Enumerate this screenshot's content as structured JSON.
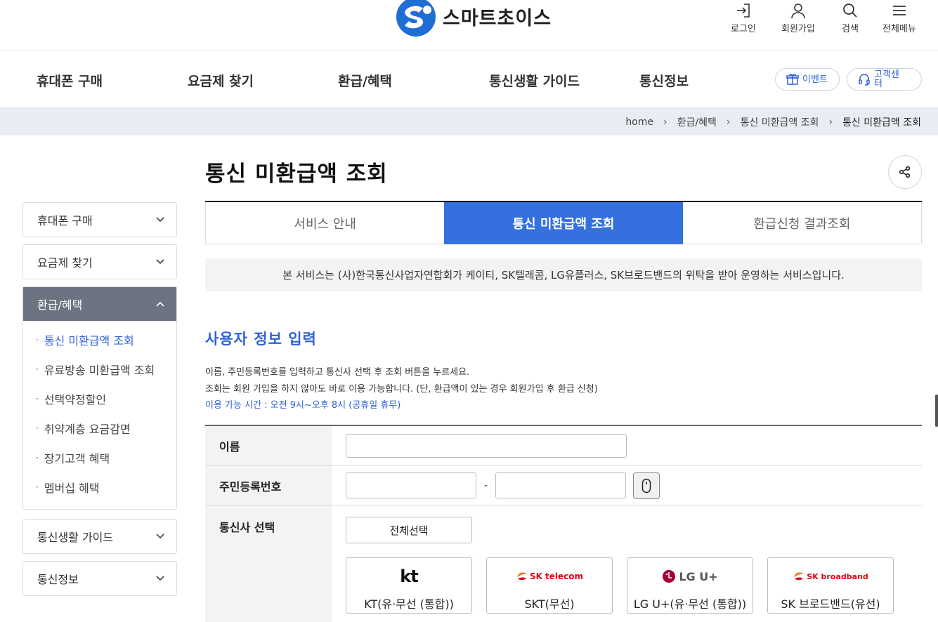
{
  "header": {
    "brand": "스마트초이스",
    "util": [
      {
        "label": "로그인",
        "icon": "login-icon"
      },
      {
        "label": "회원가입",
        "icon": "user-icon"
      },
      {
        "label": "검색",
        "icon": "search-icon"
      },
      {
        "label": "전체메뉴",
        "icon": "menu-icon"
      }
    ]
  },
  "gnb": {
    "items": [
      "휴대폰 구매",
      "요금제 찾기",
      "환급/혜택",
      "통신생활 가이드",
      "통신정보"
    ],
    "event_label": "이벤트",
    "support_label": "고객센터"
  },
  "breadcrumb": [
    "home",
    "환급/혜택",
    "통신 미환급액 조회",
    "통신 미환급액 조회"
  ],
  "page_title": "통신 미환급액 조회",
  "sidebar": {
    "sections": [
      {
        "label": "휴대폰 구매"
      },
      {
        "label": "요금제 찾기"
      },
      {
        "label": "환급/혜택",
        "sub": [
          "통신 미환급액 조회",
          "유료방송 미환급액 조회",
          "선택약정할인",
          "취약계층 요금감면",
          "장기고객 혜택",
          "멤버십 혜택"
        ]
      },
      {
        "label": "통신생활 가이드"
      },
      {
        "label": "통신정보"
      }
    ]
  },
  "tabs": [
    "서비스 안내",
    "통신 미환급액 조회",
    "환급신청 결과조회"
  ],
  "notice": "본 서비스는 (사)한국통신사업자연합회가 케이티, SK텔레콤, LG유플러스, SK브로드밴드의 위탁을 받아 운영하는 서비스입니다.",
  "section_title": "사용자 정보 입력",
  "desc": {
    "line1": "이름, 주민등록번호를 입력하고 통신사 선택 후 조회 버튼을 누르세요.",
    "line2": "조회는 회원 가입을 하지 않아도 바로 이용 가능합니다. (단, 환급액이 있는 경우 회원가입 후 환급 신청)",
    "hours": "이용 가능 시간 : 오전 9시~오후 8시 (공휴일 휴무)"
  },
  "form": {
    "name_label": "이름",
    "name_value": "",
    "rrn_label": "주민등록번호",
    "rrn_sep": "-",
    "carrier_label": "통신사 선택",
    "select_all": "전체선택",
    "carriers": [
      {
        "logo": "kt",
        "name": "KT(유·무선 (통합))"
      },
      {
        "logo": "SK telecom",
        "name": "SKT(무선)"
      },
      {
        "logo": "LG U+",
        "name": "LG U+(유·무선 (통합))"
      },
      {
        "logo": "SK broadband",
        "name": "SK 브로드밴드(유선)"
      }
    ]
  },
  "colors": {
    "accent": "#3470de",
    "link": "#2f62d6",
    "sidebar_active": "#6b7480"
  }
}
